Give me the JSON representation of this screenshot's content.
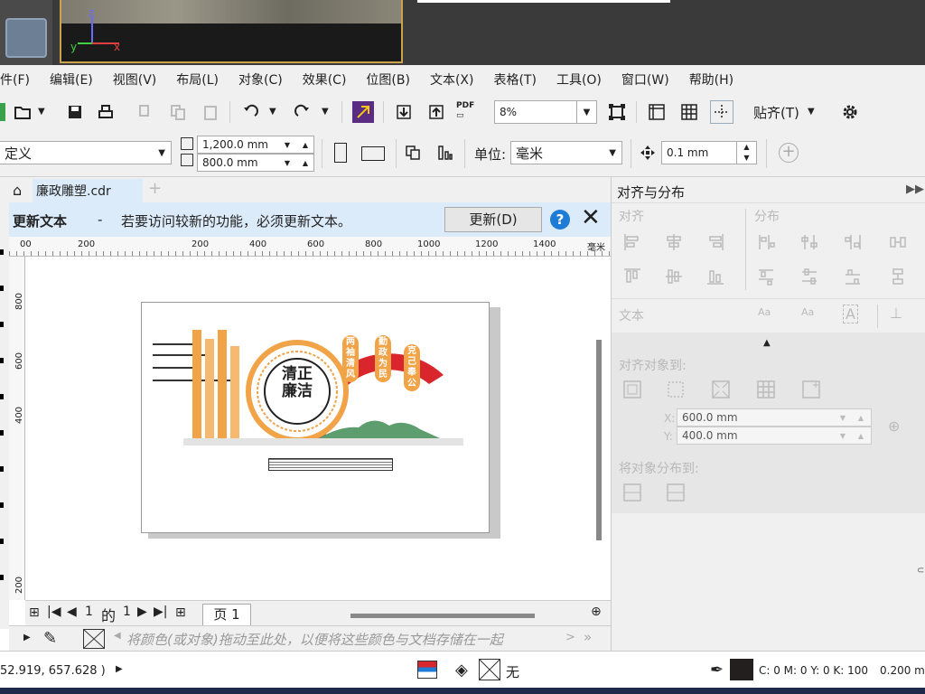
{
  "colors": {
    "accent": "#3c78d8",
    "tab_bg": "#dcebfa",
    "orange": "#f0a347",
    "red": "#d9262c",
    "green": "#5e9e6e",
    "info": "#1f7cd6"
  },
  "menu": [
    "件(F)",
    "编辑(E)",
    "视图(V)",
    "布局(L)",
    "对象(C)",
    "效果(C)",
    "位图(B)",
    "文本(X)",
    "表格(T)",
    "工具(O)",
    "窗口(W)",
    "帮助(H)"
  ],
  "toolbar": {
    "zoom": "8%",
    "snap_label": "贴齐(T)",
    "pdf": "PDF"
  },
  "propbar": {
    "preset": "定义",
    "width": "1,200.0 mm",
    "height": "800.0 mm",
    "unit_label": "单位:",
    "unit": "毫米",
    "nudge": "0.1 mm"
  },
  "doc": {
    "tab": "廉政雕塑.cdr"
  },
  "notice": {
    "title": "更新文本",
    "dash": "-",
    "message": "若要访问较新的功能，必须更新文本。",
    "button": "更新(D)",
    "info": "?"
  },
  "ruler": {
    "ticks": [
      "00",
      "200",
      "200",
      "400",
      "600",
      "800",
      "1000",
      "1200",
      "1400",
      "毫米"
    ],
    "vticks": [
      "800",
      "600",
      "400",
      "200"
    ]
  },
  "artwork": {
    "big_char": "廉",
    "center": "清正\n廉洁",
    "banners": [
      "两袖清风",
      "勤政为民",
      "克己奉公"
    ]
  },
  "pager": {
    "current": "1",
    "of": "的",
    "total": "1",
    "page_tab": "页 1"
  },
  "palette": {
    "hint": "将颜色(或对象)拖动至此处，以便将这些颜色与文档存储在一起"
  },
  "panel": {
    "title": "对齐与分布",
    "align": "对齐",
    "distribute": "分布",
    "text": "文本",
    "align_to": "对齐对象到:",
    "x_label": "X:",
    "x": "600.0 mm",
    "y_label": "Y:",
    "y": "400.0 mm",
    "distribute_to": "将对象分布到:"
  },
  "status": {
    "coords": "52.919, 657.628 )",
    "fill": "无",
    "color_info": "C: 0 M: 0 Y: 0 K: 100",
    "outline": "0.200 m"
  }
}
